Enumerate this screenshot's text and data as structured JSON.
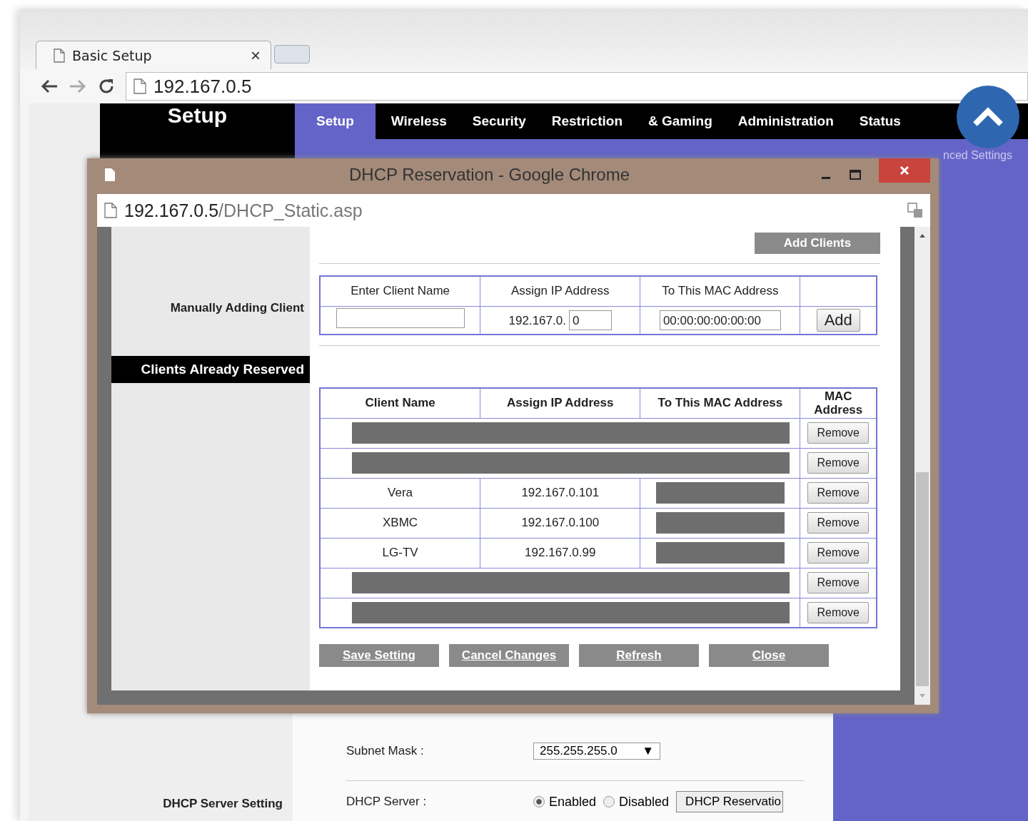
{
  "browser": {
    "tab_title": "Basic Setup",
    "tab_close": "×",
    "url": "192.167.0.5"
  },
  "router_page": {
    "brand_title": "Setup",
    "nav": [
      {
        "label": "Setup",
        "selected": true
      },
      {
        "label": "Wireless",
        "selected": false
      },
      {
        "label": "Security",
        "selected": false
      },
      {
        "label": "Restriction",
        "selected": false
      },
      {
        "label": "& Gaming",
        "selected": false
      },
      {
        "label": "Administration",
        "selected": false
      },
      {
        "label": "Status",
        "selected": false
      }
    ],
    "subnav_visible": "nced Settings",
    "subnet_mask": {
      "label": "Subnet Mask :",
      "value": "255.255.255.0",
      "arrow": "▼"
    },
    "dhcp_section_label": "DHCP Server Setting",
    "dhcp_server": {
      "label": "DHCP Server :",
      "options": [
        {
          "label": "Enabled",
          "selected": true
        },
        {
          "label": "Disabled",
          "selected": false
        }
      ],
      "reservation_button": "DHCP Reservatio"
    }
  },
  "popup": {
    "title": "DHCP Reservation - Google Chrome",
    "url_host": "192.167.0.5",
    "url_path": "/DHCP_Static.asp",
    "add_clients_button": "Add Clients",
    "manual_label": "Manually Adding Client",
    "manual_table": {
      "columns": [
        "Enter Client Name",
        "Assign IP Address",
        "To This MAC Address"
      ],
      "ip_prefix": "192.167.0.",
      "ip_value": "0",
      "mac_value": "00:00:00:00:00:00",
      "add_button": "Add"
    },
    "reserved_label": "Clients Already Reserved",
    "reserved_table": {
      "columns": [
        "Client Name",
        "Assign IP Address",
        "To This MAC Address",
        "MAC Address"
      ],
      "rows": [
        {
          "kind": "redacted",
          "remove_button": "Remove"
        },
        {
          "kind": "redacted",
          "remove_button": "Remove"
        },
        {
          "kind": "entry",
          "client_name": "Vera",
          "ip": "192.167.0.101",
          "remove_button": "Remove"
        },
        {
          "kind": "entry",
          "client_name": "XBMC",
          "ip": "192.167.0.100",
          "remove_button": "Remove"
        },
        {
          "kind": "entry",
          "client_name": "LG-TV",
          "ip": "192.167.0.99",
          "remove_button": "Remove"
        },
        {
          "kind": "redacted",
          "remove_button": "Remove"
        },
        {
          "kind": "redacted",
          "remove_button": "Remove"
        }
      ]
    },
    "buttons": [
      "Save Setting",
      "Cancel Changes",
      "Refresh",
      "Close"
    ]
  }
}
